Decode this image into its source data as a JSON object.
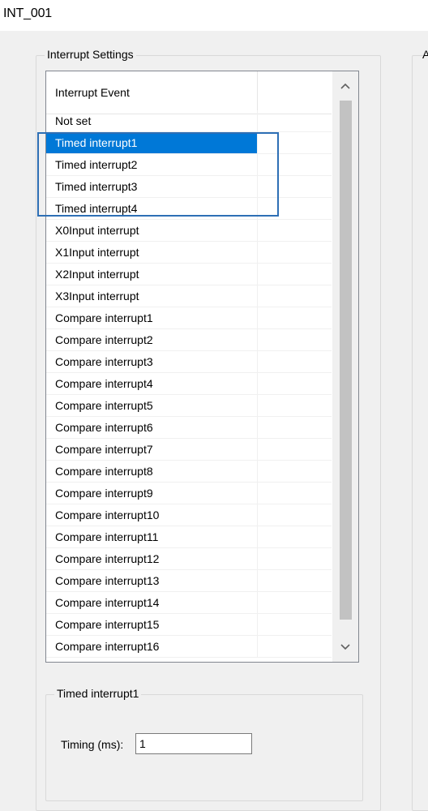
{
  "window": {
    "title": "INT_001"
  },
  "interrupt_settings": {
    "legend": "Interrupt Settings",
    "column_header": "Interrupt Event",
    "selected_index": 1,
    "rows": [
      "Not set",
      "Timed interrupt1",
      "Timed interrupt2",
      "Timed interrupt3",
      "Timed interrupt4",
      "X0Input interrupt",
      "X1Input interrupt",
      "X2Input interrupt",
      "X3Input interrupt",
      "Compare interrupt1",
      "Compare interrupt2",
      "Compare interrupt3",
      "Compare interrupt4",
      "Compare interrupt5",
      "Compare interrupt6",
      "Compare interrupt7",
      "Compare interrupt8",
      "Compare interrupt9",
      "Compare interrupt10",
      "Compare interrupt11",
      "Compare interrupt12",
      "Compare interrupt13",
      "Compare interrupt14",
      "Compare interrupt15",
      "Compare interrupt16"
    ]
  },
  "right_group": {
    "legend_partial": "A"
  },
  "timed_group": {
    "legend": "Timed interrupt1",
    "timing_label": "Timing (ms):",
    "timing_value": "1"
  },
  "icons": {
    "scroll_up": "chevron-up-icon",
    "scroll_down": "chevron-down-icon"
  },
  "colors": {
    "selection": "#0078d7",
    "highlight_box": "#2e6fb5"
  }
}
